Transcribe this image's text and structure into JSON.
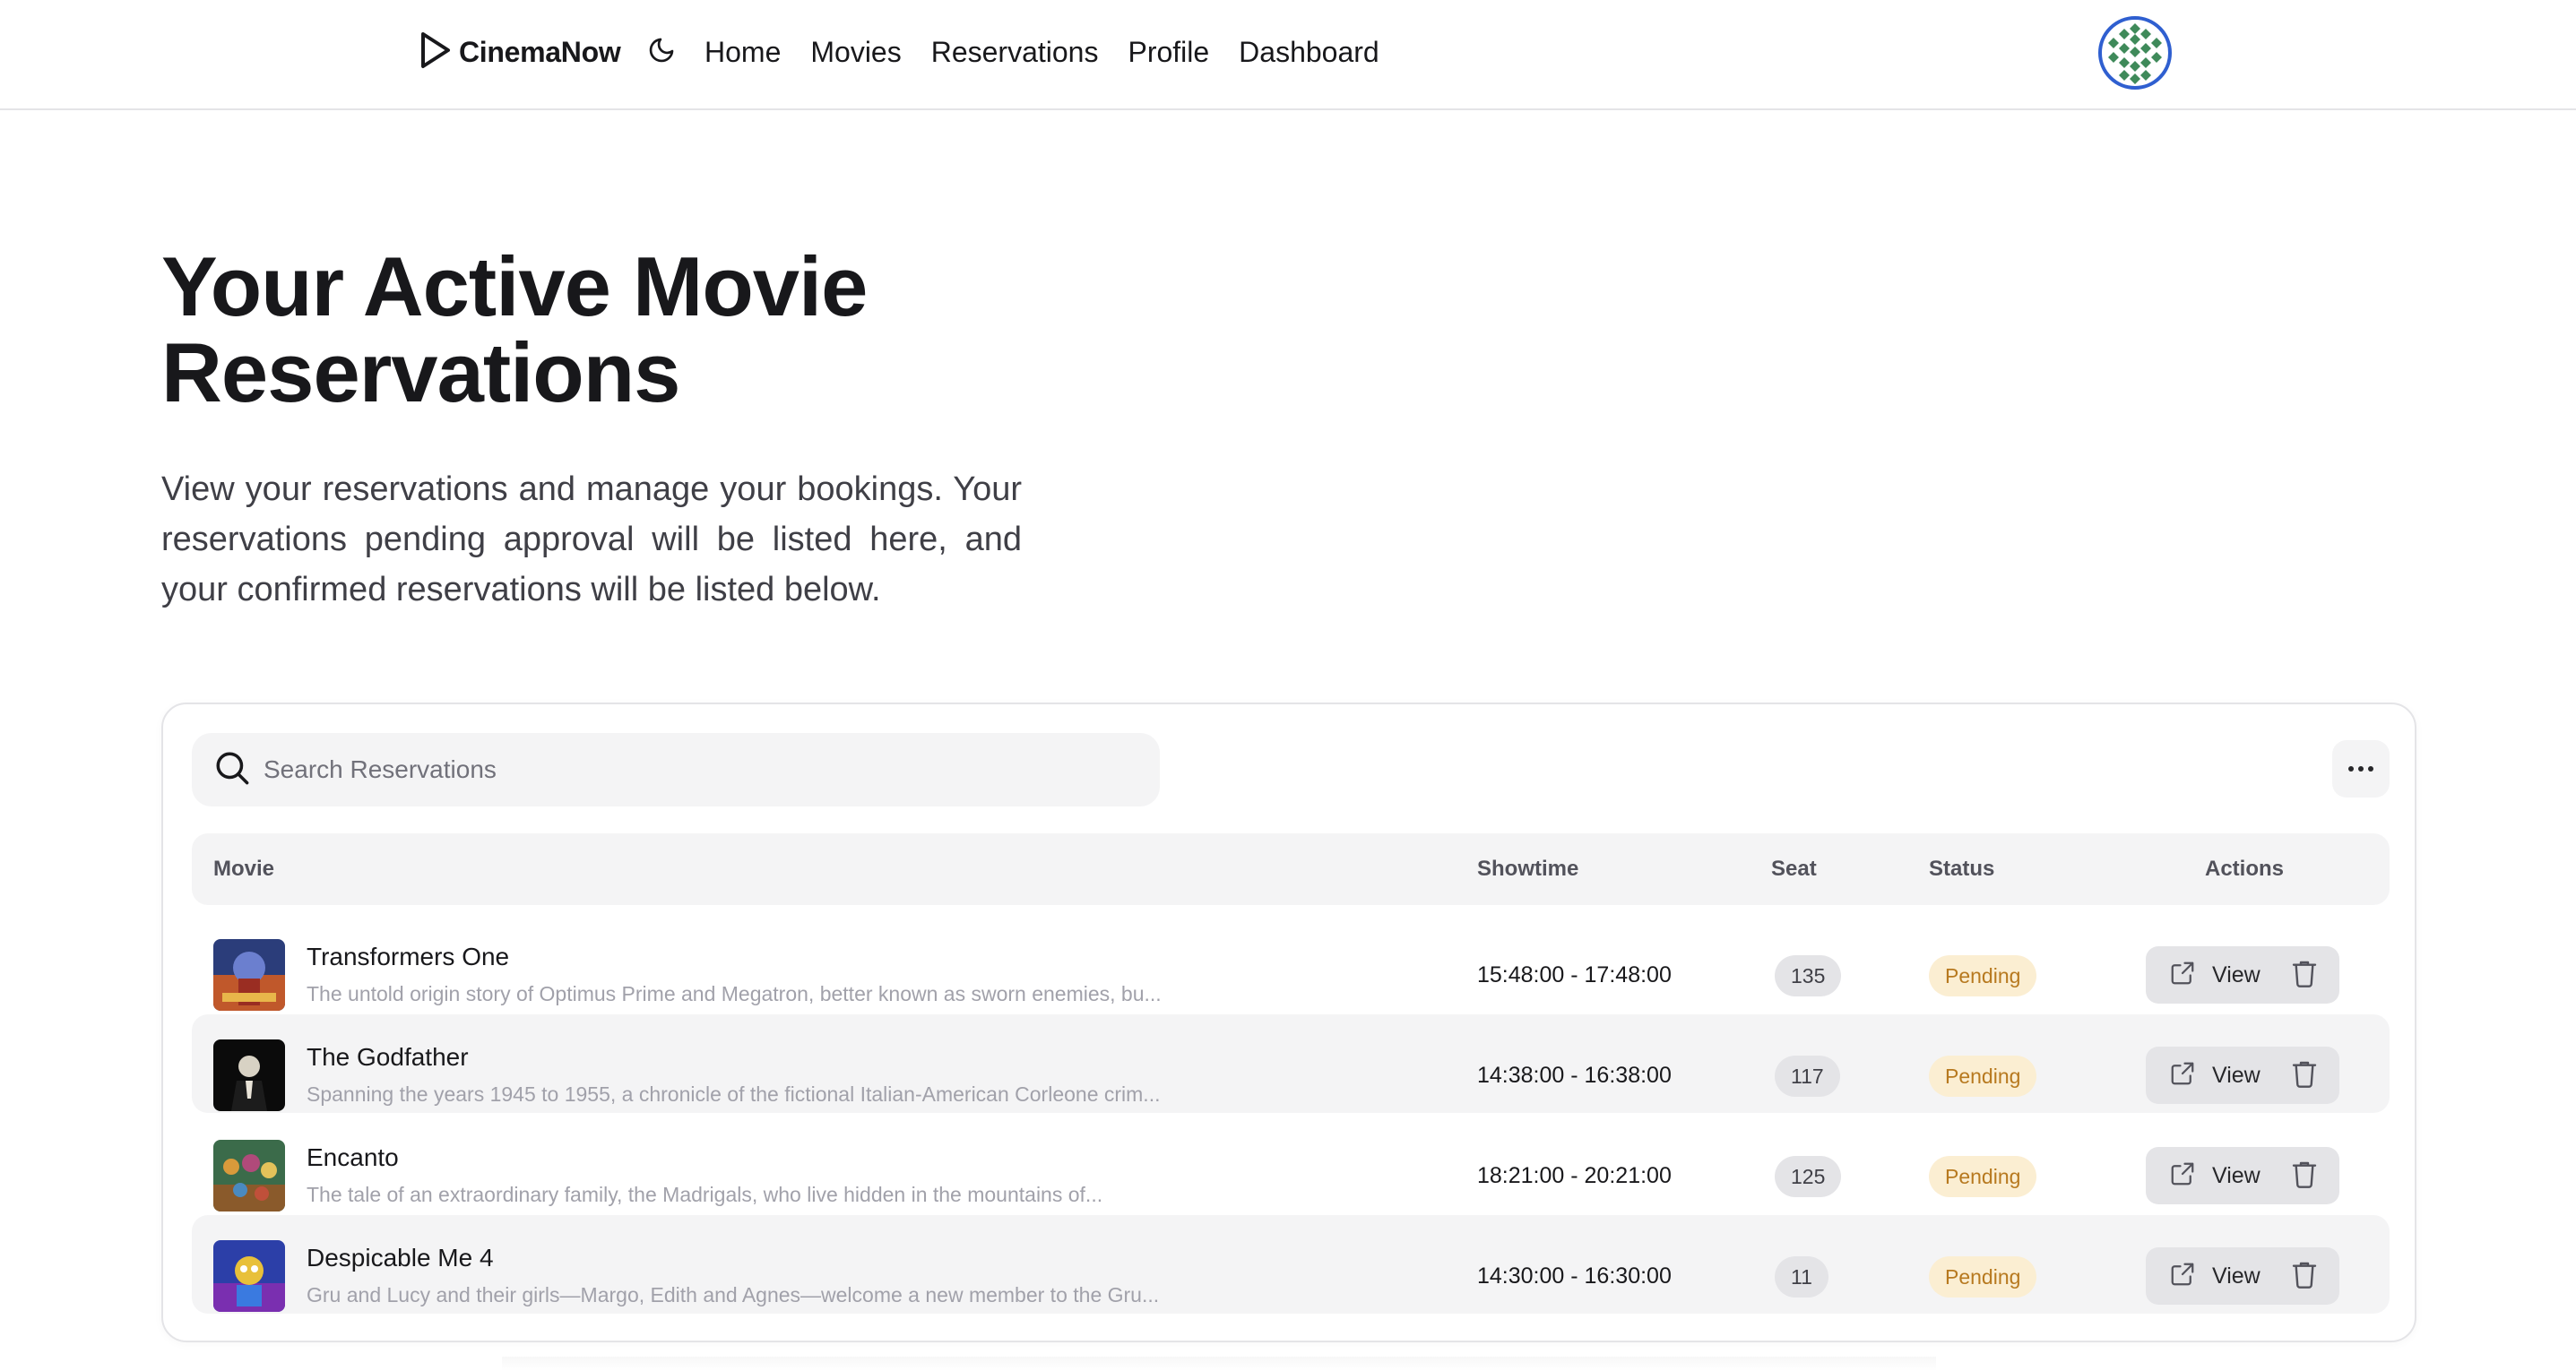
{
  "header": {
    "brand": "CinemaNow",
    "nav": [
      "Home",
      "Movies",
      "Reservations",
      "Profile",
      "Dashboard"
    ],
    "icons": {
      "logo": "play-triangle-icon",
      "theme": "moon-icon",
      "avatar": "user-avatar"
    }
  },
  "hero": {
    "title": "Your Active Movie Reservations",
    "description": "View your reservations and manage your bookings. Your reservations pending approval will be listed here, and your confirmed reservations will be listed below."
  },
  "search": {
    "placeholder": "Search Reservations"
  },
  "table": {
    "columns": [
      "Movie",
      "Showtime",
      "Seat",
      "Status",
      "Actions"
    ],
    "rows": [
      {
        "title": "Transformers One",
        "description": "The untold origin story of Optimus Prime and Megatron, better known as sworn enemies, bu...",
        "showtime": "15:48:00 - 17:48:00",
        "seat": "135",
        "status": "Pending",
        "view_label": "View"
      },
      {
        "title": "The Godfather",
        "description": "Spanning the years 1945 to 1955, a chronicle of the fictional Italian-American Corleone crim...",
        "showtime": "14:38:00 - 16:38:00",
        "seat": "117",
        "status": "Pending",
        "view_label": "View"
      },
      {
        "title": "Encanto",
        "description": "The tale of an extraordinary family, the Madrigals, who live hidden in the mountains of...",
        "showtime": "18:21:00 - 20:21:00",
        "seat": "125",
        "status": "Pending",
        "view_label": "View"
      },
      {
        "title": "Despicable Me 4",
        "description": "Gru and Lucy and their girls—Margo, Edith and Agnes—welcome a new member to the Gru...",
        "showtime": "14:30:00 - 16:30:00",
        "seat": "11",
        "status": "Pending",
        "view_label": "View"
      }
    ]
  },
  "colors": {
    "status_pending_bg": "#fbeed2",
    "status_pending_text": "#b7791f",
    "avatar_ring": "#2f5fd0",
    "avatar_pattern": "#3f8a5a"
  }
}
